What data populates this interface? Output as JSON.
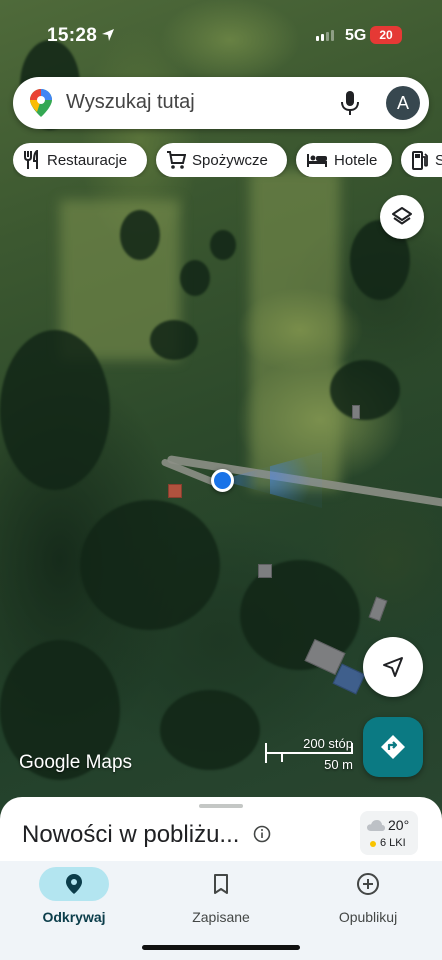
{
  "status_bar": {
    "time": "15:28",
    "network": "5G",
    "battery": "20"
  },
  "search": {
    "placeholder": "Wyszukaj tutaj",
    "avatar_letter": "A"
  },
  "chips": [
    {
      "label": "Restauracje",
      "icon": "fork-knife-icon"
    },
    {
      "label": "Spożywcze",
      "icon": "cart-icon"
    },
    {
      "label": "Hotele",
      "icon": "bed-icon"
    },
    {
      "label": "S",
      "icon": "gas-pump-icon"
    }
  ],
  "map": {
    "logo_google": "Google",
    "logo_maps": "Maps",
    "scale_feet": "200 stóp",
    "scale_meters": "50 m"
  },
  "sheet": {
    "title": "Nowości w pobliżu...",
    "weather_temp": "20°",
    "weather_aqi": "6 LKI"
  },
  "bottom_nav": [
    {
      "label": "Odkrywaj",
      "icon": "location-pin-icon",
      "active": true
    },
    {
      "label": "Zapisane",
      "icon": "bookmark-icon",
      "active": false
    },
    {
      "label": "Opublikuj",
      "icon": "plus-circle-icon",
      "active": false
    }
  ],
  "colors": {
    "accent": "#1a73e8",
    "directions_button": "#0b7a83",
    "active_nav_pill": "#b3e5f0",
    "battery_badge": "#e53935"
  }
}
